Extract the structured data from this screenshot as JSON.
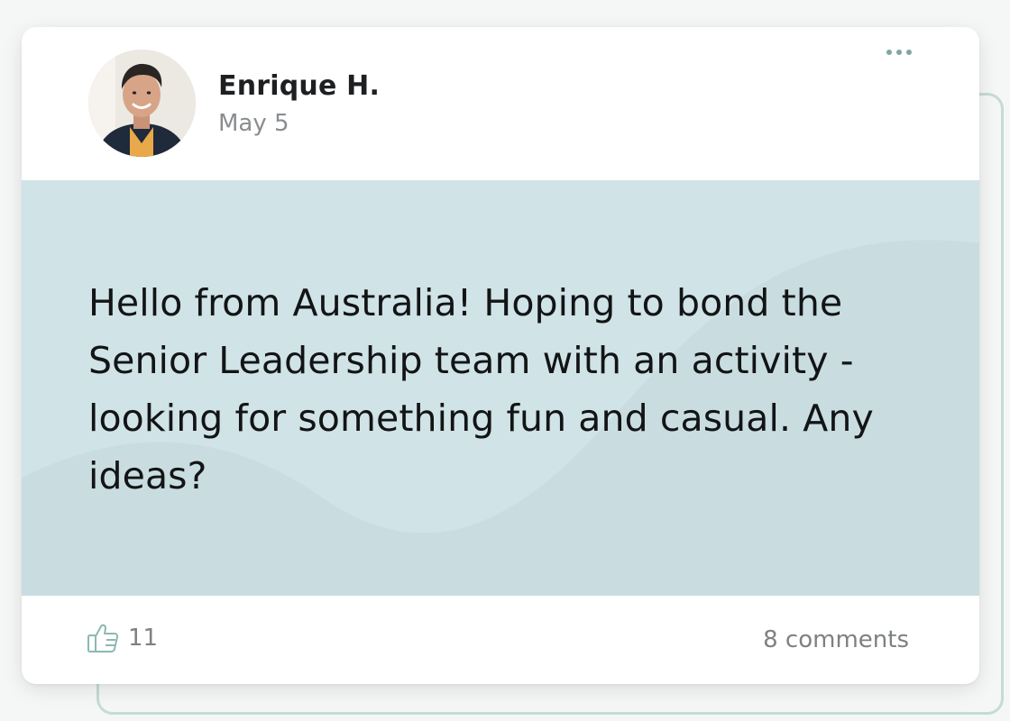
{
  "post": {
    "author": {
      "name": "Enrique H.",
      "avatar_icon": "person-portrait"
    },
    "date": "May 5",
    "menu_icon": "more-horizontal-icon",
    "body_text": "Hello from Australia! Hoping to bond the Senior Leadership team with an activity - looking for something fun and casual. Any ideas?",
    "body_background_color": "#d0e3e6",
    "likes": {
      "icon": "thumbs-up-icon",
      "count": "11"
    },
    "comments_label": "8 comments"
  },
  "colors": {
    "accent_outline": "#c4dcd4",
    "icon_color": "#7fa7a4"
  }
}
